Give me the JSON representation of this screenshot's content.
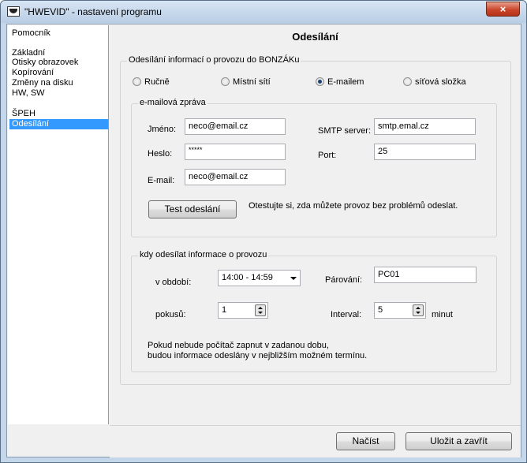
{
  "window": {
    "title": "\"HWEVID\" - nastavení programu",
    "close_symbol": "×"
  },
  "sidebar": {
    "items": [
      {
        "label": "Pomocník"
      },
      {
        "label": "Základní"
      },
      {
        "label": "Otisky obrazovek"
      },
      {
        "label": "Kopírování"
      },
      {
        "label": "Změny na disku"
      },
      {
        "label": "HW, SW"
      },
      {
        "label": "ŠPEH"
      },
      {
        "label": "Odesílání",
        "selected": true
      }
    ]
  },
  "main": {
    "heading": "Odesílání",
    "send_group": {
      "legend": "Odesílání informací o provozu do BONZÁKu",
      "options": [
        "Ručně",
        "Místní sítí",
        "E-mailem",
        "síťová složka"
      ],
      "selected": "E-mailem"
    },
    "email_group": {
      "legend": "e-mailová zpráva",
      "name_label": "Jméno:",
      "name_value": "neco@email.cz",
      "password_label": "Heslo:",
      "password_value": "*****",
      "email_label": "E-mail:",
      "email_value": "neco@email.cz",
      "smtp_label": "SMTP server:",
      "smtp_value": "smtp.emal.cz",
      "port_label": "Port:",
      "port_value": "25",
      "test_button": "Test odeslání",
      "test_hint": "Otestujte si, zda můžete provoz bez problémů odeslat."
    },
    "when_group": {
      "legend": "kdy odesílat informace o provozu",
      "period_label": "v období:",
      "period_value": "14:00 - 14:59",
      "pairing_label": "Párování:",
      "pairing_value": "PC01",
      "attempts_label": "pokusů:",
      "attempts_value": "1",
      "interval_label": "Interval:",
      "interval_value": "5",
      "interval_unit": "minut",
      "note_line1": "Pokud nebude počítač zapnut v zadanou dobu,",
      "note_line2": "budou informace odeslány v nejbližším možném termínu."
    }
  },
  "footer": {
    "load_button": "Načíst",
    "save_close_button": "Uložit a zavřít"
  }
}
